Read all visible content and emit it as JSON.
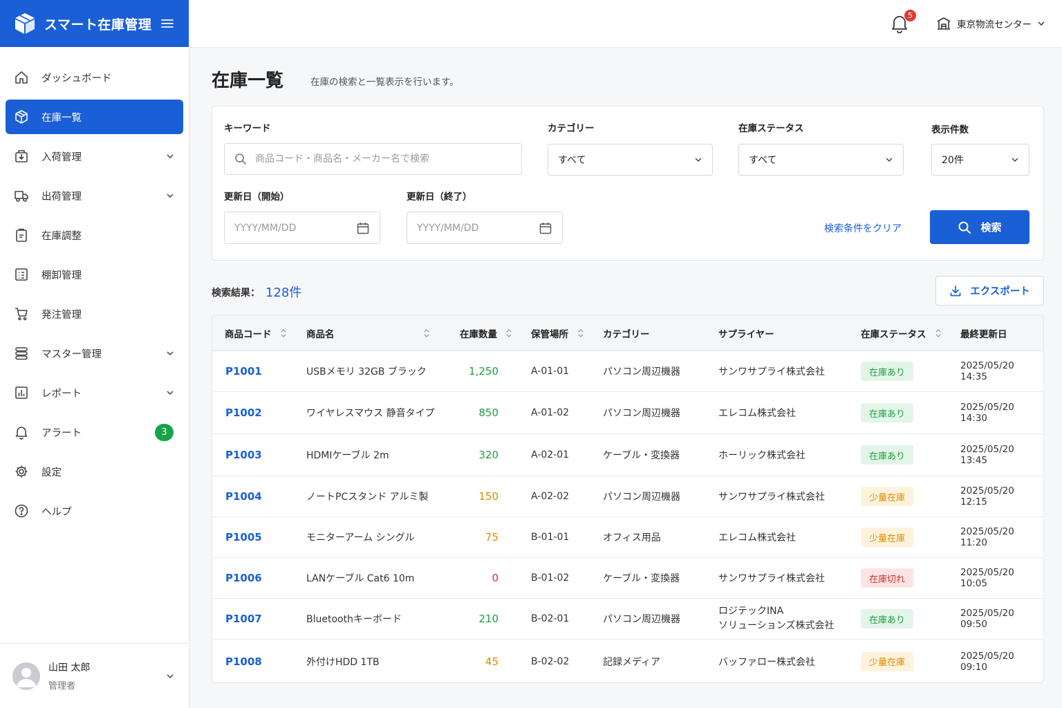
{
  "app": {
    "title": "スマート在庫管理"
  },
  "topbar": {
    "notification_count": "5",
    "center": "東京物流センター"
  },
  "sidebar": {
    "items": [
      {
        "label": "ダッシュボード"
      },
      {
        "label": "在庫一覧"
      },
      {
        "label": "入荷管理"
      },
      {
        "label": "出荷管理"
      },
      {
        "label": "在庫調整"
      },
      {
        "label": "棚卸管理"
      },
      {
        "label": "発注管理"
      },
      {
        "label": "マスター管理"
      },
      {
        "label": "レポート"
      },
      {
        "label": "アラート",
        "badge": "3"
      },
      {
        "label": "設定"
      },
      {
        "label": "ヘルプ"
      }
    ],
    "user": {
      "name": "山田 太郎",
      "role": "管理者"
    }
  },
  "page": {
    "title": "在庫一覧",
    "subtitle": "在庫の検索と一覧表示を行います。"
  },
  "filters": {
    "keyword_label": "キーワード",
    "keyword_placeholder": "商品コード・商品名・メーカー名で検索",
    "category_label": "カテゴリー",
    "category_value": "すべて",
    "status_label": "在庫ステータス",
    "status_value": "すべて",
    "count_label": "表示件数",
    "count_value": "20件",
    "date_start_label": "更新日（開始）",
    "date_start_placeholder": "YYYY/MM/DD",
    "date_end_label": "更新日（終了）",
    "date_end_placeholder": "YYYY/MM/DD",
    "clear_label": "検索条件をクリア",
    "search_label": "検索"
  },
  "results": {
    "label": "検索結果：",
    "count": "128件",
    "export_label": "エクスポート"
  },
  "table": {
    "headers": [
      "商品コード",
      "商品名",
      "在庫数量",
      "保管場所",
      "カテゴリー",
      "サプライヤー",
      "在庫ステータス",
      "最終更新日"
    ],
    "rows": [
      {
        "code": "P1001",
        "name": "USBメモリ 32GB ブラック",
        "qty": "1,250",
        "location": "A-01-01",
        "category": "パソコン周辺機器",
        "supplier": "サンワサプライ株式会社",
        "supplier2": "",
        "status": "在庫あり",
        "status_type": "ok",
        "updated": "2025/05/20 14:35"
      },
      {
        "code": "P1002",
        "name": "ワイヤレスマウス 静音タイプ",
        "qty": "850",
        "location": "A-01-02",
        "category": "パソコン周辺機器",
        "supplier": "エレコム株式会社",
        "supplier2": "",
        "status": "在庫あり",
        "status_type": "ok",
        "updated": "2025/05/20 14:30"
      },
      {
        "code": "P1003",
        "name": "HDMIケーブル 2m",
        "qty": "320",
        "location": "A-02-01",
        "category": "ケーブル・変換器",
        "supplier": "ホーリック株式会社",
        "supplier2": "",
        "status": "在庫あり",
        "status_type": "ok",
        "updated": "2025/05/20 13:45"
      },
      {
        "code": "P1004",
        "name": "ノートPCスタンド アルミ製",
        "qty": "150",
        "location": "A-02-02",
        "category": "パソコン周辺機器",
        "supplier": "サンワサプライ株式会社",
        "supplier2": "",
        "status": "少量在庫",
        "status_type": "low",
        "updated": "2025/05/20 12:15"
      },
      {
        "code": "P1005",
        "name": "モニターアーム シングル",
        "qty": "75",
        "location": "B-01-01",
        "category": "オフィス用品",
        "supplier": "エレコム株式会社",
        "supplier2": "",
        "status": "少量在庫",
        "status_type": "low",
        "updated": "2025/05/20 11:20"
      },
      {
        "code": "P1006",
        "name": "LANケーブル Cat6 10m",
        "qty": "0",
        "location": "B-01-02",
        "category": "ケーブル・変換器",
        "supplier": "サンワサプライ株式会社",
        "supplier2": "",
        "status": "在庫切れ",
        "status_type": "out",
        "updated": "2025/05/20 10:05"
      },
      {
        "code": "P1007",
        "name": "Bluetoothキーボード",
        "qty": "210",
        "location": "B-02-01",
        "category": "パソコン周辺機器",
        "supplier": "ロジテックINA",
        "supplier2": "ソリューションズ株式会社",
        "status": "在庫あり",
        "status_type": "ok",
        "updated": "2025/05/20 09:50"
      },
      {
        "code": "P1008",
        "name": "外付けHDD 1TB",
        "qty": "45",
        "location": "B-02-02",
        "category": "記録メディア",
        "supplier": "バッファロー株式会社",
        "supplier2": "",
        "status": "少量在庫",
        "status_type": "low",
        "updated": "2025/05/20 09:10"
      }
    ]
  },
  "colors": {
    "accent": "#1a5fd6",
    "ok": "#1e9e3e",
    "low": "#e08a00",
    "out": "#d32f2f"
  }
}
